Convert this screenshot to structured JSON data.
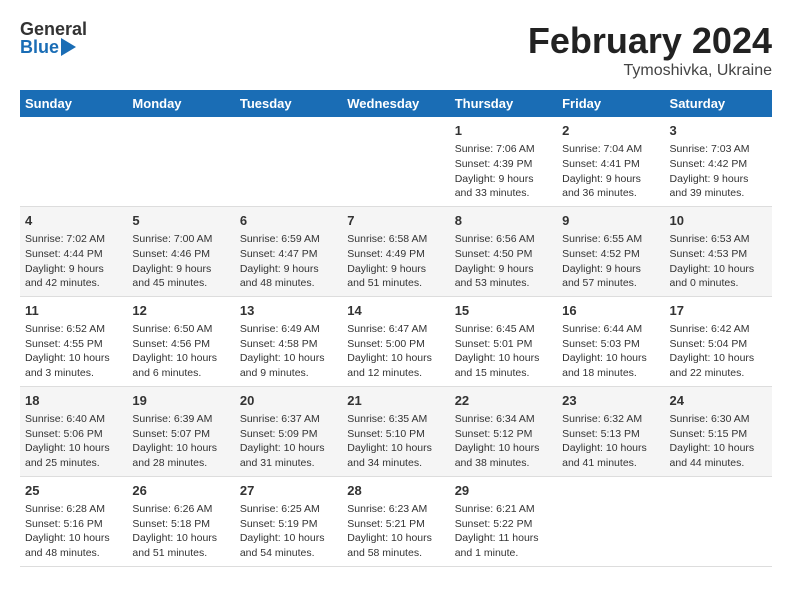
{
  "header": {
    "logo_general": "General",
    "logo_blue": "Blue",
    "title": "February 2024",
    "subtitle": "Tymoshivka, Ukraine"
  },
  "calendar": {
    "days_of_week": [
      "Sunday",
      "Monday",
      "Tuesday",
      "Wednesday",
      "Thursday",
      "Friday",
      "Saturday"
    ],
    "weeks": [
      [
        {
          "day": "",
          "info": ""
        },
        {
          "day": "",
          "info": ""
        },
        {
          "day": "",
          "info": ""
        },
        {
          "day": "",
          "info": ""
        },
        {
          "day": "1",
          "info": "Sunrise: 7:06 AM\nSunset: 4:39 PM\nDaylight: 9 hours\nand 33 minutes."
        },
        {
          "day": "2",
          "info": "Sunrise: 7:04 AM\nSunset: 4:41 PM\nDaylight: 9 hours\nand 36 minutes."
        },
        {
          "day": "3",
          "info": "Sunrise: 7:03 AM\nSunset: 4:42 PM\nDaylight: 9 hours\nand 39 minutes."
        }
      ],
      [
        {
          "day": "4",
          "info": "Sunrise: 7:02 AM\nSunset: 4:44 PM\nDaylight: 9 hours\nand 42 minutes."
        },
        {
          "day": "5",
          "info": "Sunrise: 7:00 AM\nSunset: 4:46 PM\nDaylight: 9 hours\nand 45 minutes."
        },
        {
          "day": "6",
          "info": "Sunrise: 6:59 AM\nSunset: 4:47 PM\nDaylight: 9 hours\nand 48 minutes."
        },
        {
          "day": "7",
          "info": "Sunrise: 6:58 AM\nSunset: 4:49 PM\nDaylight: 9 hours\nand 51 minutes."
        },
        {
          "day": "8",
          "info": "Sunrise: 6:56 AM\nSunset: 4:50 PM\nDaylight: 9 hours\nand 53 minutes."
        },
        {
          "day": "9",
          "info": "Sunrise: 6:55 AM\nSunset: 4:52 PM\nDaylight: 9 hours\nand 57 minutes."
        },
        {
          "day": "10",
          "info": "Sunrise: 6:53 AM\nSunset: 4:53 PM\nDaylight: 10 hours\nand 0 minutes."
        }
      ],
      [
        {
          "day": "11",
          "info": "Sunrise: 6:52 AM\nSunset: 4:55 PM\nDaylight: 10 hours\nand 3 minutes."
        },
        {
          "day": "12",
          "info": "Sunrise: 6:50 AM\nSunset: 4:56 PM\nDaylight: 10 hours\nand 6 minutes."
        },
        {
          "day": "13",
          "info": "Sunrise: 6:49 AM\nSunset: 4:58 PM\nDaylight: 10 hours\nand 9 minutes."
        },
        {
          "day": "14",
          "info": "Sunrise: 6:47 AM\nSunset: 5:00 PM\nDaylight: 10 hours\nand 12 minutes."
        },
        {
          "day": "15",
          "info": "Sunrise: 6:45 AM\nSunset: 5:01 PM\nDaylight: 10 hours\nand 15 minutes."
        },
        {
          "day": "16",
          "info": "Sunrise: 6:44 AM\nSunset: 5:03 PM\nDaylight: 10 hours\nand 18 minutes."
        },
        {
          "day": "17",
          "info": "Sunrise: 6:42 AM\nSunset: 5:04 PM\nDaylight: 10 hours\nand 22 minutes."
        }
      ],
      [
        {
          "day": "18",
          "info": "Sunrise: 6:40 AM\nSunset: 5:06 PM\nDaylight: 10 hours\nand 25 minutes."
        },
        {
          "day": "19",
          "info": "Sunrise: 6:39 AM\nSunset: 5:07 PM\nDaylight: 10 hours\nand 28 minutes."
        },
        {
          "day": "20",
          "info": "Sunrise: 6:37 AM\nSunset: 5:09 PM\nDaylight: 10 hours\nand 31 minutes."
        },
        {
          "day": "21",
          "info": "Sunrise: 6:35 AM\nSunset: 5:10 PM\nDaylight: 10 hours\nand 34 minutes."
        },
        {
          "day": "22",
          "info": "Sunrise: 6:34 AM\nSunset: 5:12 PM\nDaylight: 10 hours\nand 38 minutes."
        },
        {
          "day": "23",
          "info": "Sunrise: 6:32 AM\nSunset: 5:13 PM\nDaylight: 10 hours\nand 41 minutes."
        },
        {
          "day": "24",
          "info": "Sunrise: 6:30 AM\nSunset: 5:15 PM\nDaylight: 10 hours\nand 44 minutes."
        }
      ],
      [
        {
          "day": "25",
          "info": "Sunrise: 6:28 AM\nSunset: 5:16 PM\nDaylight: 10 hours\nand 48 minutes."
        },
        {
          "day": "26",
          "info": "Sunrise: 6:26 AM\nSunset: 5:18 PM\nDaylight: 10 hours\nand 51 minutes."
        },
        {
          "day": "27",
          "info": "Sunrise: 6:25 AM\nSunset: 5:19 PM\nDaylight: 10 hours\nand 54 minutes."
        },
        {
          "day": "28",
          "info": "Sunrise: 6:23 AM\nSunset: 5:21 PM\nDaylight: 10 hours\nand 58 minutes."
        },
        {
          "day": "29",
          "info": "Sunrise: 6:21 AM\nSunset: 5:22 PM\nDaylight: 11 hours\nand 1 minute."
        },
        {
          "day": "",
          "info": ""
        },
        {
          "day": "",
          "info": ""
        }
      ]
    ]
  }
}
